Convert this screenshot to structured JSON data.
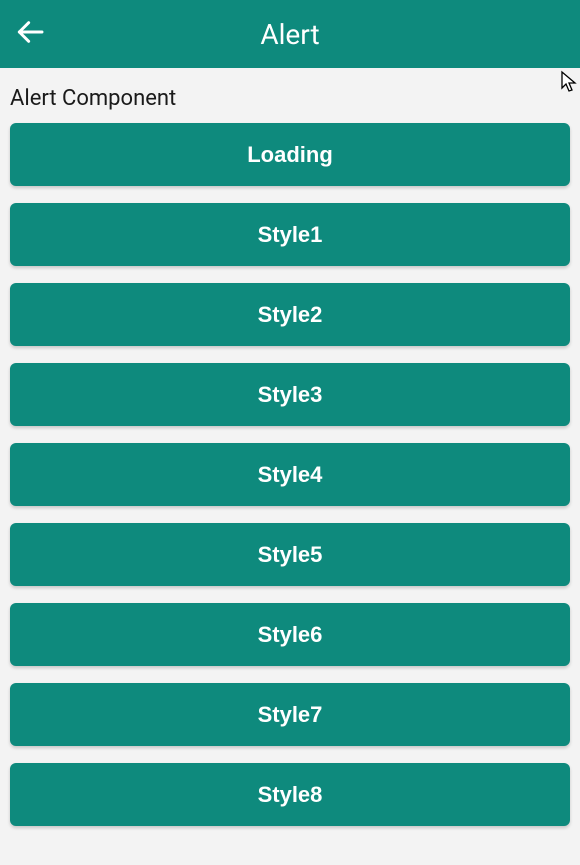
{
  "header": {
    "title": "Alert",
    "back_icon": "back-arrow"
  },
  "section": {
    "title": "Alert Component"
  },
  "buttons": [
    {
      "label": "Loading"
    },
    {
      "label": "Style1"
    },
    {
      "label": "Style2"
    },
    {
      "label": "Style3"
    },
    {
      "label": "Style4"
    },
    {
      "label": "Style5"
    },
    {
      "label": "Style6"
    },
    {
      "label": "Style7"
    },
    {
      "label": "Style8"
    }
  ],
  "colors": {
    "accent": "#0e8a7d",
    "background": "#f3f3f3",
    "button_text": "#ffffff"
  }
}
